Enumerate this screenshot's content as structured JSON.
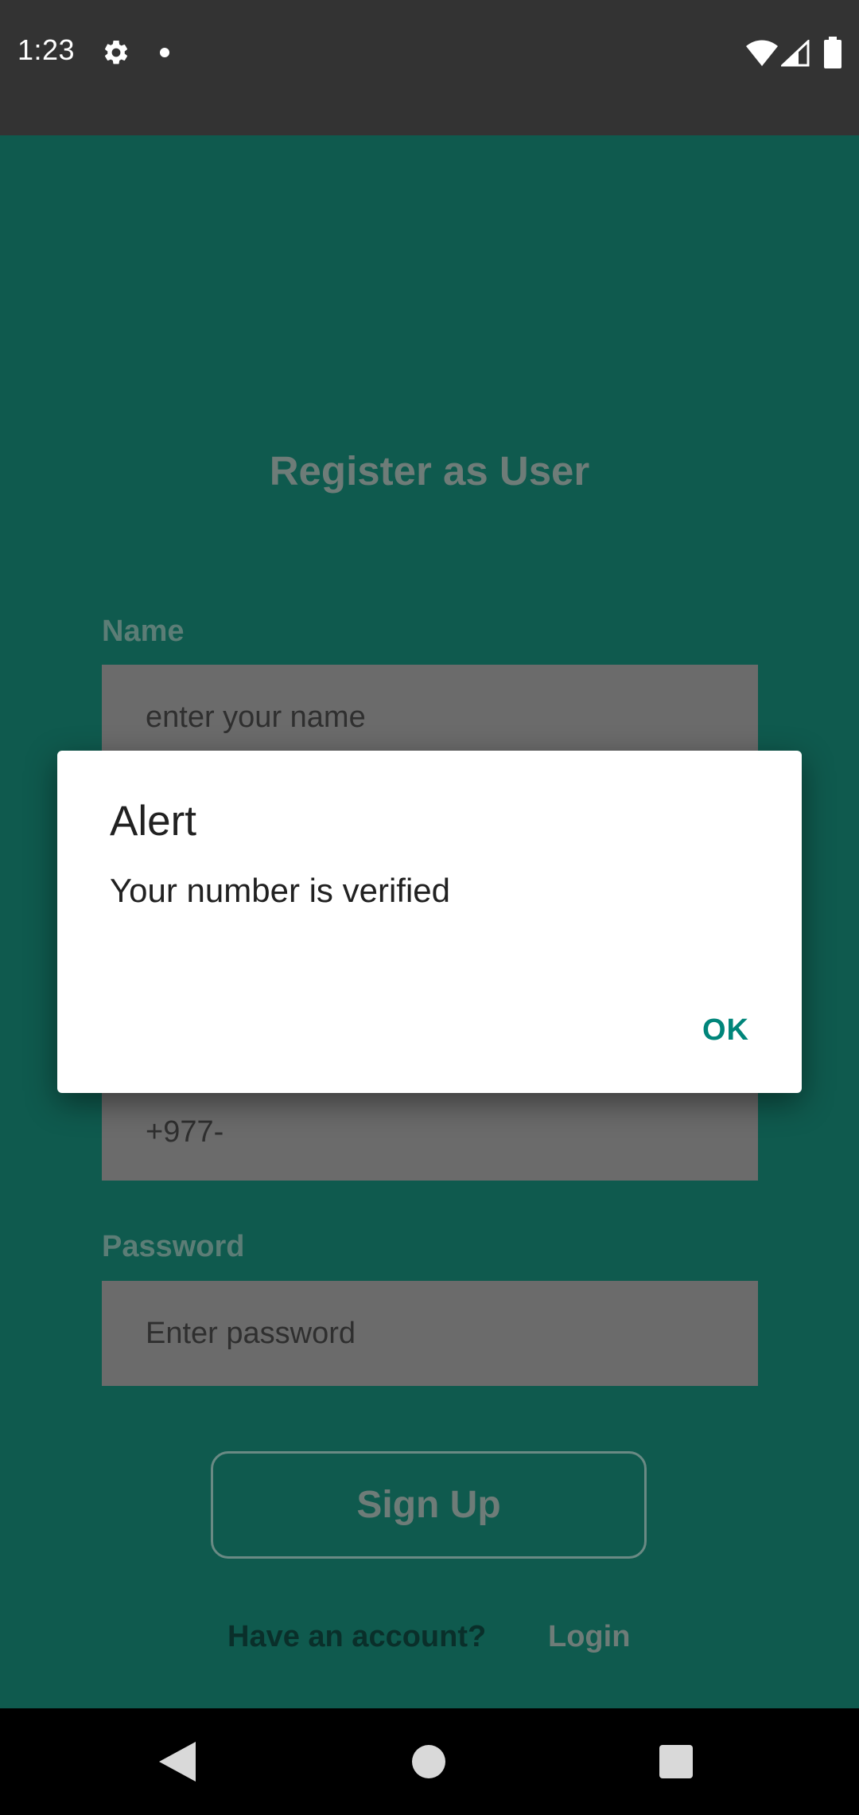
{
  "status_bar": {
    "time": "1:23",
    "icons": [
      "gear-icon",
      "notification-dot-icon",
      "wifi-icon",
      "signal-icon",
      "battery-icon"
    ]
  },
  "form": {
    "title": "Register as User",
    "name_label": "Name",
    "name_placeholder": "enter your name",
    "phone_value": "+977-",
    "password_label": "Password",
    "password_placeholder": "Enter password",
    "signup_label": "Sign Up",
    "have_account_text": "Have an account?",
    "login_label": "Login"
  },
  "dialog": {
    "title": "Alert",
    "message": "Your number is verified",
    "ok_label": "OK"
  },
  "colors": {
    "background": "#0f5a4e",
    "accent": "#00857a",
    "status_bar": "#333333"
  },
  "nav_bar": {
    "icons": [
      "back-icon",
      "home-icon",
      "recents-icon"
    ]
  }
}
